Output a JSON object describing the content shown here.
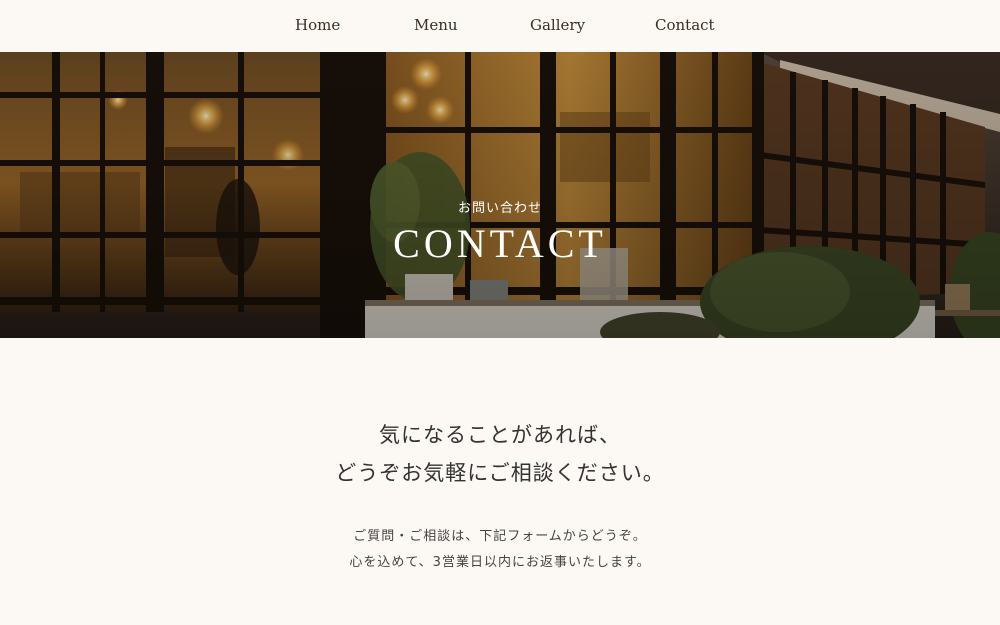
{
  "nav": {
    "items": [
      {
        "label": "Home"
      },
      {
        "label": "Menu"
      },
      {
        "label": "Gallery"
      },
      {
        "label": "Contact"
      }
    ]
  },
  "hero": {
    "subtitle": "お問い合わせ",
    "title": "CONTACT"
  },
  "intro": {
    "line1": "気になることがあれば、",
    "line2": "どうぞお気軽にご相談ください。"
  },
  "note": {
    "line1": "ご質問・ご相談は、下記フォームからどうぞ。",
    "line2": "心を込めて、3営業日以内にお返事いたします。"
  }
}
